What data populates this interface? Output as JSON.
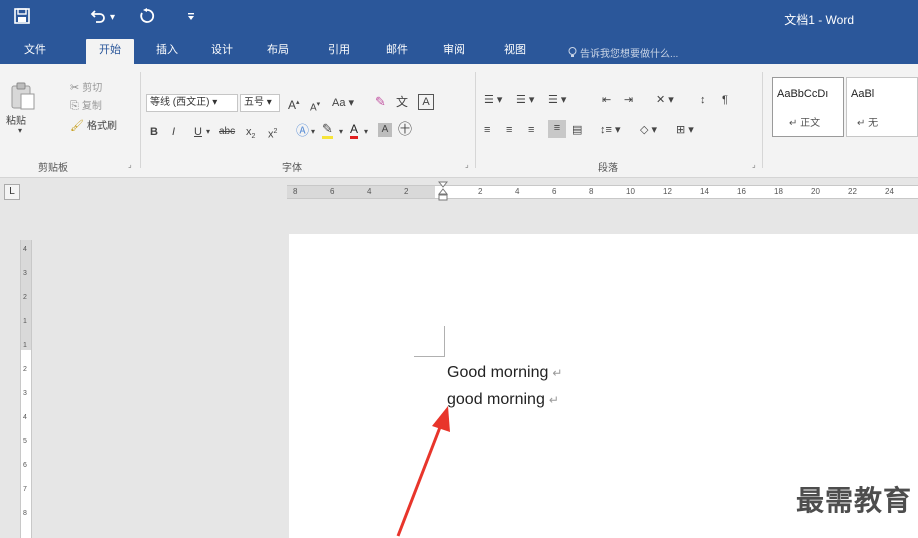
{
  "title_bar": {
    "doc_title": "文档1 - Word",
    "quick_access": [
      {
        "icon": "save-icon",
        "glyph": "🖫"
      },
      {
        "icon": "undo-icon",
        "glyph": "↶"
      },
      {
        "icon": "redo-icon",
        "glyph": "↻"
      },
      {
        "icon": "customize-icon",
        "glyph": "⯆"
      }
    ],
    "undo_dropdown": "▾"
  },
  "tabs": [
    {
      "label": "文件"
    },
    {
      "label": "开始",
      "active": true
    },
    {
      "label": "插入"
    },
    {
      "label": "设计"
    },
    {
      "label": "布局"
    },
    {
      "label": "引用"
    },
    {
      "label": "邮件"
    },
    {
      "label": "审阅"
    },
    {
      "label": "视图"
    }
  ],
  "tell_me": {
    "placeholder": "告诉我您想要做什么..."
  },
  "clipboard": {
    "paste_label": "粘贴",
    "cut_label": "剪切",
    "copy_label": "复制",
    "format_painter_label": "格式刷",
    "group_label": "剪贴板"
  },
  "font": {
    "font_name": "等线 (西文正)",
    "font_size": "五号",
    "grow_label": "A",
    "shrink_label": "A",
    "case_label": "Aa",
    "bold": "B",
    "italic": "I",
    "underline": "U",
    "strike": "abc",
    "subscript": "x",
    "superscript": "x",
    "group_label": "字体"
  },
  "paragraph": {
    "group_label": "段落"
  },
  "styles": [
    {
      "sample": "AaBbCcDı",
      "name": "正文",
      "selected": true
    },
    {
      "sample": "AaBl",
      "name": "无"
    }
  ],
  "ruler": {
    "tab_selector": "L",
    "ticks": [
      "8",
      "6",
      "4",
      "2",
      "",
      "2",
      "4",
      "6",
      "8",
      "10",
      "12",
      "14",
      "16",
      "18",
      "20",
      "22",
      "24"
    ]
  },
  "vruler_ticks": [
    "4",
    "3",
    "2",
    "1",
    "1",
    "2",
    "3",
    "4",
    "5",
    "6",
    "7",
    "8"
  ],
  "document": {
    "lines": [
      "Good morning",
      "good morning"
    ],
    "para_mark": "↵"
  },
  "watermark": "最需教育",
  "colors": {
    "titlebar": "#2b579a",
    "ribbon": "#f3f3f3",
    "arrow": "#e8352b"
  }
}
